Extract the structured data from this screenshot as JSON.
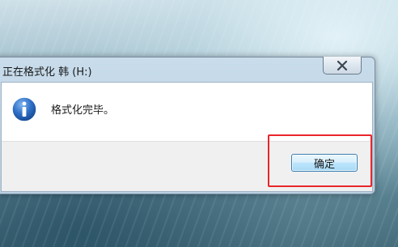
{
  "dialog": {
    "title": "正在格式化 韩 (H:)",
    "message": "格式化完毕。",
    "ok_label": "确定",
    "icon": "info-icon",
    "close_icon": "close-icon"
  },
  "colors": {
    "highlight": "#e8262a",
    "info_icon": "#1f5fb4",
    "button_border": "#3c7fb1"
  }
}
